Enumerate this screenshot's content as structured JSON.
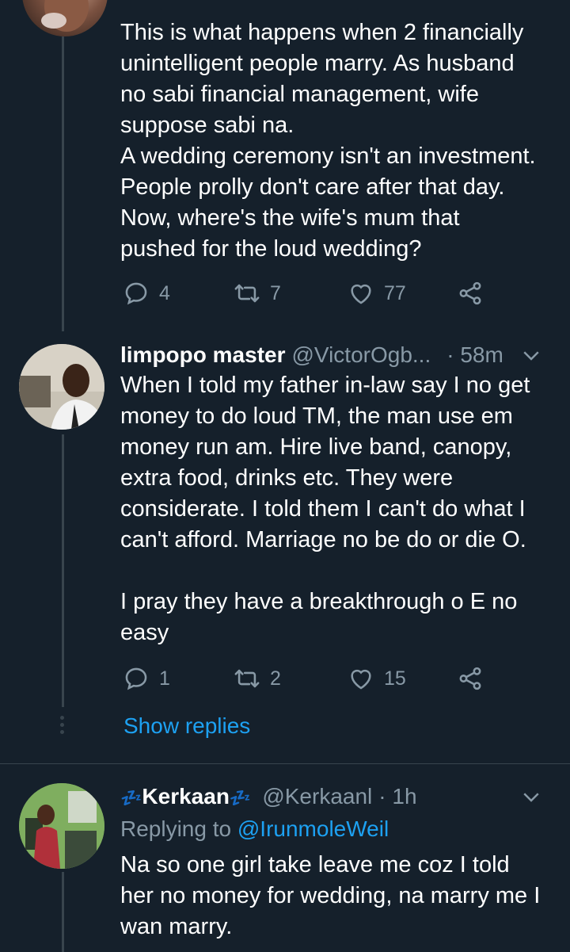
{
  "tweet1": {
    "text": "This is what happens when 2 financially\nunintelligent people marry. As husband\nno sabi financial management, wife\nsuppose sabi na.\nA wedding ceremony isn't an investment.\nPeople prolly don't care after that day.\nNow, where's the wife's mum that\npushed for the loud wedding?",
    "replies": "4",
    "retweets": "7",
    "likes": "77"
  },
  "tweet2": {
    "name": "limpopo master",
    "handle": "@VictorOgb...",
    "time": "· 58m",
    "text": "When I told my father in-law say I no get\nmoney to do loud TM, the man use em\nmoney run am. Hire live band, canopy,\nextra food, drinks etc. They were\nconsiderate. I told them I can't do what I\ncan't afford. Marriage no be do or die O.\n\nI pray they have a breakthrough o E no\neasy",
    "replies": "1",
    "retweets": "2",
    "likes": "15",
    "show_replies": "Show replies"
  },
  "tweet3": {
    "name_emoji_left": "💤",
    "name": "Kerkaan",
    "name_emoji_right": "💤",
    "handle": "@Kerkaanl",
    "time": "· 1h",
    "replying_prefix": "Replying to",
    "replying_to": "@IrunmoleWeil",
    "text": "Na so one girl take leave me coz I told\nher no money for wedding, na marry me I\nwan marry."
  },
  "colors": {
    "background": "#15202b",
    "text": "#ffffff",
    "muted": "#8899a6",
    "accent": "#1da1f2",
    "divider": "#38444d"
  },
  "icons": {
    "reply": "reply-icon",
    "retweet": "retweet-icon",
    "like": "heart-icon",
    "share": "share-icon",
    "more": "chevron-down-icon"
  }
}
